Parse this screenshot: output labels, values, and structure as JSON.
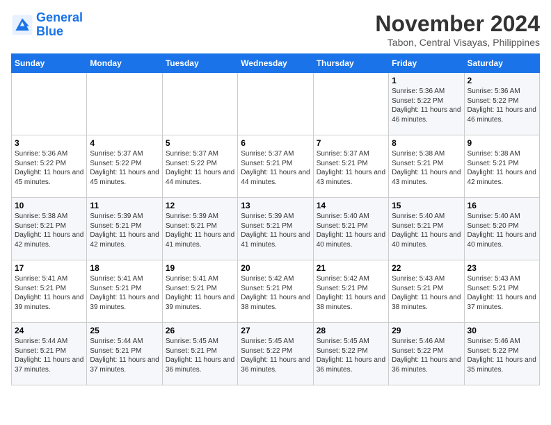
{
  "logo": {
    "line1": "General",
    "line2": "Blue"
  },
  "title": "November 2024",
  "subtitle": "Tabon, Central Visayas, Philippines",
  "days_of_week": [
    "Sunday",
    "Monday",
    "Tuesday",
    "Wednesday",
    "Thursday",
    "Friday",
    "Saturday"
  ],
  "weeks": [
    [
      {
        "day": "",
        "info": ""
      },
      {
        "day": "",
        "info": ""
      },
      {
        "day": "",
        "info": ""
      },
      {
        "day": "",
        "info": ""
      },
      {
        "day": "",
        "info": ""
      },
      {
        "day": "1",
        "info": "Sunrise: 5:36 AM\nSunset: 5:22 PM\nDaylight: 11 hours and 46 minutes."
      },
      {
        "day": "2",
        "info": "Sunrise: 5:36 AM\nSunset: 5:22 PM\nDaylight: 11 hours and 46 minutes."
      }
    ],
    [
      {
        "day": "3",
        "info": "Sunrise: 5:36 AM\nSunset: 5:22 PM\nDaylight: 11 hours and 45 minutes."
      },
      {
        "day": "4",
        "info": "Sunrise: 5:37 AM\nSunset: 5:22 PM\nDaylight: 11 hours and 45 minutes."
      },
      {
        "day": "5",
        "info": "Sunrise: 5:37 AM\nSunset: 5:22 PM\nDaylight: 11 hours and 44 minutes."
      },
      {
        "day": "6",
        "info": "Sunrise: 5:37 AM\nSunset: 5:21 PM\nDaylight: 11 hours and 44 minutes."
      },
      {
        "day": "7",
        "info": "Sunrise: 5:37 AM\nSunset: 5:21 PM\nDaylight: 11 hours and 43 minutes."
      },
      {
        "day": "8",
        "info": "Sunrise: 5:38 AM\nSunset: 5:21 PM\nDaylight: 11 hours and 43 minutes."
      },
      {
        "day": "9",
        "info": "Sunrise: 5:38 AM\nSunset: 5:21 PM\nDaylight: 11 hours and 42 minutes."
      }
    ],
    [
      {
        "day": "10",
        "info": "Sunrise: 5:38 AM\nSunset: 5:21 PM\nDaylight: 11 hours and 42 minutes."
      },
      {
        "day": "11",
        "info": "Sunrise: 5:39 AM\nSunset: 5:21 PM\nDaylight: 11 hours and 42 minutes."
      },
      {
        "day": "12",
        "info": "Sunrise: 5:39 AM\nSunset: 5:21 PM\nDaylight: 11 hours and 41 minutes."
      },
      {
        "day": "13",
        "info": "Sunrise: 5:39 AM\nSunset: 5:21 PM\nDaylight: 11 hours and 41 minutes."
      },
      {
        "day": "14",
        "info": "Sunrise: 5:40 AM\nSunset: 5:21 PM\nDaylight: 11 hours and 40 minutes."
      },
      {
        "day": "15",
        "info": "Sunrise: 5:40 AM\nSunset: 5:21 PM\nDaylight: 11 hours and 40 minutes."
      },
      {
        "day": "16",
        "info": "Sunrise: 5:40 AM\nSunset: 5:20 PM\nDaylight: 11 hours and 40 minutes."
      }
    ],
    [
      {
        "day": "17",
        "info": "Sunrise: 5:41 AM\nSunset: 5:21 PM\nDaylight: 11 hours and 39 minutes."
      },
      {
        "day": "18",
        "info": "Sunrise: 5:41 AM\nSunset: 5:21 PM\nDaylight: 11 hours and 39 minutes."
      },
      {
        "day": "19",
        "info": "Sunrise: 5:41 AM\nSunset: 5:21 PM\nDaylight: 11 hours and 39 minutes."
      },
      {
        "day": "20",
        "info": "Sunrise: 5:42 AM\nSunset: 5:21 PM\nDaylight: 11 hours and 38 minutes."
      },
      {
        "day": "21",
        "info": "Sunrise: 5:42 AM\nSunset: 5:21 PM\nDaylight: 11 hours and 38 minutes."
      },
      {
        "day": "22",
        "info": "Sunrise: 5:43 AM\nSunset: 5:21 PM\nDaylight: 11 hours and 38 minutes."
      },
      {
        "day": "23",
        "info": "Sunrise: 5:43 AM\nSunset: 5:21 PM\nDaylight: 11 hours and 37 minutes."
      }
    ],
    [
      {
        "day": "24",
        "info": "Sunrise: 5:44 AM\nSunset: 5:21 PM\nDaylight: 11 hours and 37 minutes."
      },
      {
        "day": "25",
        "info": "Sunrise: 5:44 AM\nSunset: 5:21 PM\nDaylight: 11 hours and 37 minutes."
      },
      {
        "day": "26",
        "info": "Sunrise: 5:45 AM\nSunset: 5:21 PM\nDaylight: 11 hours and 36 minutes."
      },
      {
        "day": "27",
        "info": "Sunrise: 5:45 AM\nSunset: 5:22 PM\nDaylight: 11 hours and 36 minutes."
      },
      {
        "day": "28",
        "info": "Sunrise: 5:45 AM\nSunset: 5:22 PM\nDaylight: 11 hours and 36 minutes."
      },
      {
        "day": "29",
        "info": "Sunrise: 5:46 AM\nSunset: 5:22 PM\nDaylight: 11 hours and 36 minutes."
      },
      {
        "day": "30",
        "info": "Sunrise: 5:46 AM\nSunset: 5:22 PM\nDaylight: 11 hours and 35 minutes."
      }
    ]
  ]
}
